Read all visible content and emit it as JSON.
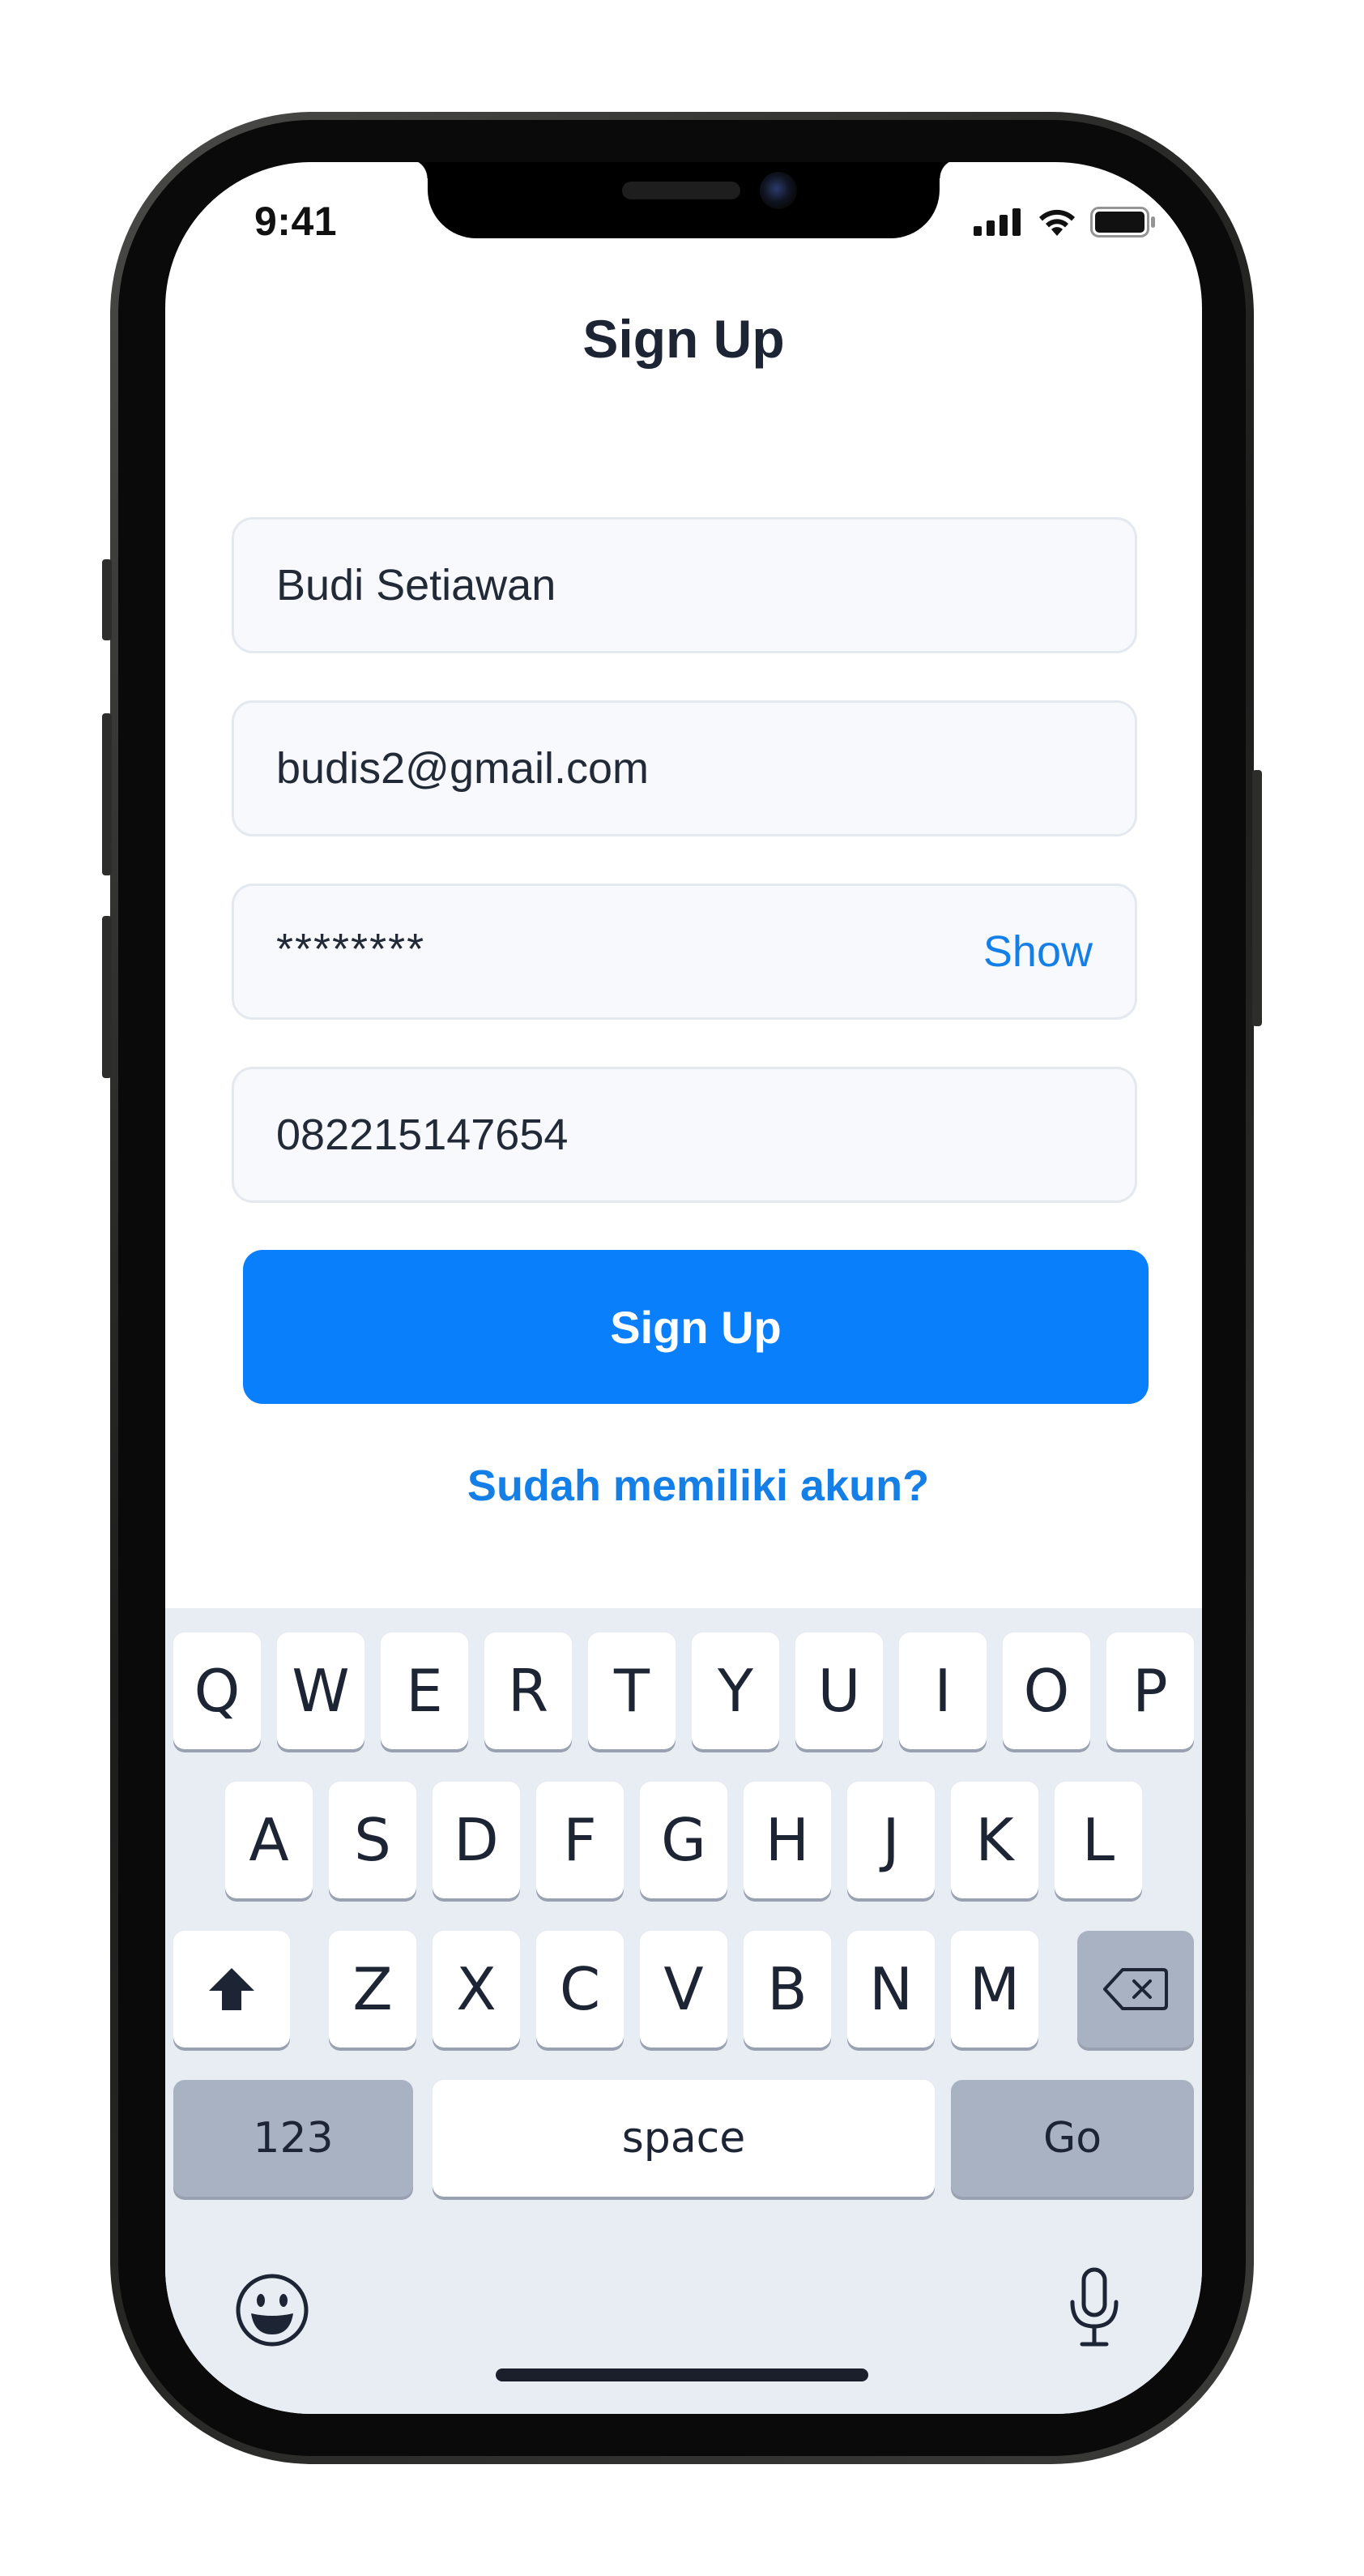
{
  "status_bar": {
    "time": "9:41"
  },
  "screen": {
    "title": "Sign Up"
  },
  "form": {
    "name_value": "Budi Setiawan",
    "email_value": "budis2@gmail.com",
    "password_value": "********",
    "password_toggle": "Show",
    "phone_value": "082215147654"
  },
  "actions": {
    "submit_label": "Sign Up",
    "login_link": "Sudah memiliki akun?"
  },
  "keyboard": {
    "row1": [
      "Q",
      "W",
      "E",
      "R",
      "T",
      "Y",
      "U",
      "I",
      "O",
      "P"
    ],
    "row2": [
      "A",
      "S",
      "D",
      "F",
      "G",
      "H",
      "J",
      "K",
      "L"
    ],
    "row3": [
      "Z",
      "X",
      "C",
      "V",
      "B",
      "N",
      "M"
    ],
    "numbers_label": "123",
    "space_label": "space",
    "go_label": "Go"
  },
  "colors": {
    "accent": "#0a7ffb",
    "link": "#157fe8",
    "field_bg": "#f8f9fc",
    "keyboard_bg": "#e8ecf3"
  },
  "icons": [
    "signal-icon",
    "wifi-icon",
    "battery-icon",
    "shift-icon",
    "backspace-icon",
    "emoji-icon",
    "microphone-icon"
  ]
}
